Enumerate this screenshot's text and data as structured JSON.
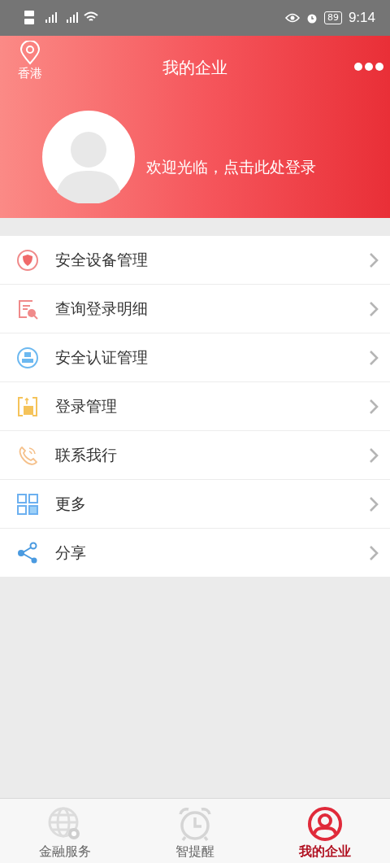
{
  "status_bar": {
    "battery": "89",
    "time": "9:14"
  },
  "header": {
    "location": "香港",
    "title": "我的企业",
    "welcome": "欢迎光临，点击此处登录"
  },
  "menu": [
    {
      "kind": "shield",
      "label": "安全设备管理"
    },
    {
      "kind": "search",
      "label": "查询登录明细"
    },
    {
      "kind": "badge",
      "label": "安全认证管理"
    },
    {
      "kind": "card",
      "label": "登录管理"
    },
    {
      "kind": "phone",
      "label": "联系我行"
    },
    {
      "kind": "grid",
      "label": "更多"
    },
    {
      "kind": "share",
      "label": "分享"
    }
  ],
  "tabs": [
    {
      "kind": "globe",
      "label": "金融服务",
      "selected": false
    },
    {
      "kind": "alarm",
      "label": "智提醒",
      "selected": false
    },
    {
      "kind": "user",
      "label": "我的企业",
      "selected": true
    }
  ]
}
